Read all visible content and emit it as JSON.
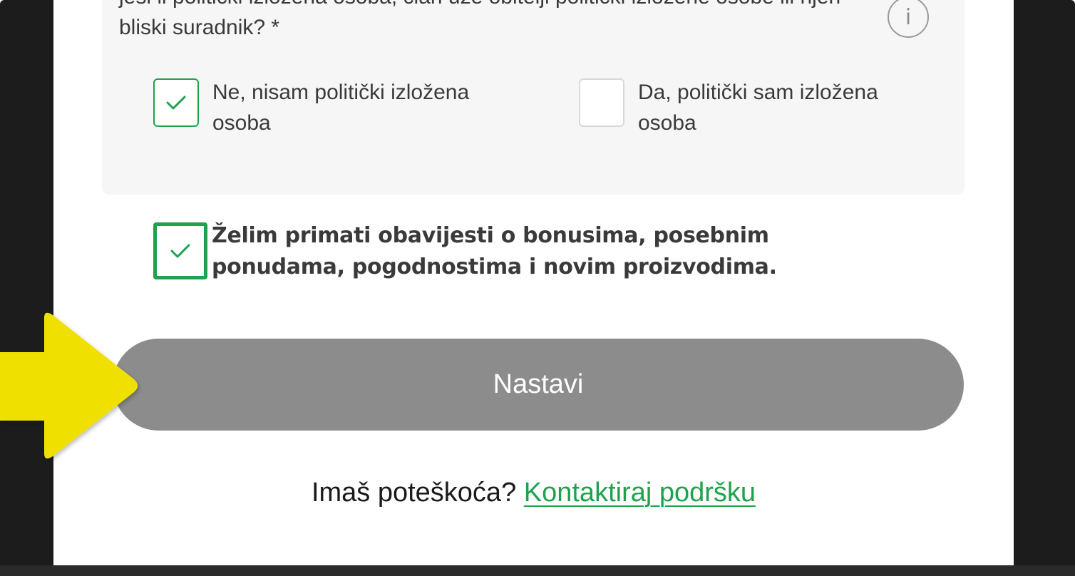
{
  "pep": {
    "question": "jesi li politički izložena osoba, član uže obitelji politički izložene osobe ili njen bliski suradnik? *",
    "info_icon": "info-icon",
    "info_glyph": "i",
    "options": [
      {
        "label": "Ne, nisam politički izložena osoba",
        "checked": true
      },
      {
        "label": "Da, politički sam izložena osoba",
        "checked": false
      }
    ]
  },
  "consent": {
    "label": "Želim primati obavijesti o bonusima, posebnim ponudama, pogodnostima i novim proizvodima.",
    "checked": true
  },
  "continue_label": "Nastavi",
  "help": {
    "text": "Imaš poteškoća?",
    "link": "Kontaktiraj podršku"
  },
  "colors": {
    "accent_green": "#1ea24c",
    "button_gray": "#8c8c8c",
    "arrow_yellow": "#f0e000",
    "frame_dark": "#1c1c1c"
  },
  "icons": {
    "check": "checkmark-icon",
    "pointer": "arrow-right-icon"
  }
}
